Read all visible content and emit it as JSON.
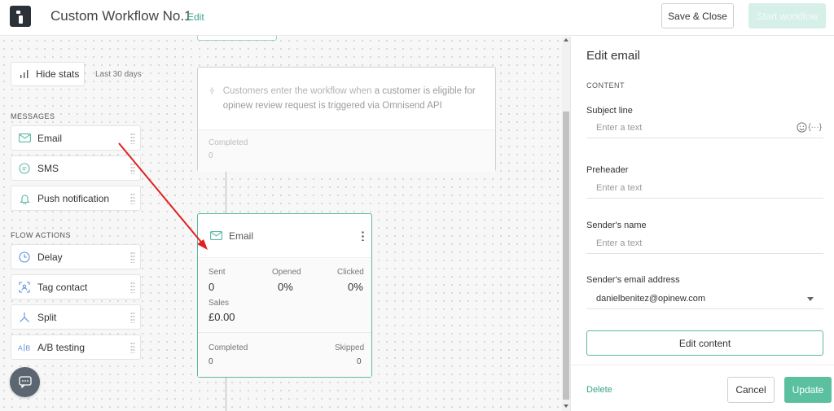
{
  "header": {
    "title": "Custom Workflow No.1",
    "edit_link": "Edit",
    "save_close": "Save & Close",
    "start_workflow": "Start workflow"
  },
  "sidebar": {
    "hide_stats": "Hide stats",
    "period": "Last 30 days",
    "messages_label": "MESSAGES",
    "messages": [
      {
        "label": "Email",
        "icon": "envelope-icon"
      },
      {
        "label": "SMS",
        "icon": "sms-bubble-icon"
      },
      {
        "label": "Push notification",
        "icon": "bell-icon"
      }
    ],
    "flow_actions_label": "FLOW ACTIONS",
    "flow_actions": [
      {
        "label": "Delay",
        "icon": "clock-icon"
      },
      {
        "label": "Tag contact",
        "icon": "tag-contact-icon"
      },
      {
        "label": "Split",
        "icon": "split-icon"
      },
      {
        "label": "A/B testing",
        "icon": "ab-testing-icon"
      }
    ]
  },
  "trigger": {
    "text_pre": "Customers enter the workflow when ",
    "text_bold": "a customer is eligible for opinew review request is triggered via Omnisend API",
    "completed_label": "Completed",
    "completed_value": "0"
  },
  "email_node": {
    "title": "Email",
    "sent_label": "Sent",
    "sent_value": "0",
    "opened_label": "Opened",
    "opened_value": "0%",
    "clicked_label": "Clicked",
    "clicked_value": "0%",
    "sales_label": "Sales",
    "sales_value": "£0.00",
    "completed_label": "Completed",
    "completed_value": "0",
    "skipped_label": "Skipped",
    "skipped_value": "0"
  },
  "panel": {
    "title": "Edit email",
    "section": "CONTENT",
    "subject_label": "Subject line",
    "subject_placeholder": "Enter a text",
    "merge_tag": "{···}",
    "preheader_label": "Preheader",
    "preheader_placeholder": "Enter a text",
    "sender_name_label": "Sender's name",
    "sender_name_placeholder": "Enter a text",
    "sender_email_label": "Sender's email address",
    "sender_email_value": "danielbenitez@opinew.com",
    "edit_content": "Edit content",
    "delete": "Delete",
    "cancel": "Cancel",
    "update": "Update"
  },
  "colors": {
    "accent": "#37a48b",
    "node_border": "#5bb8a3",
    "update_bg": "#5bc09f",
    "arrow": "#e02020"
  }
}
